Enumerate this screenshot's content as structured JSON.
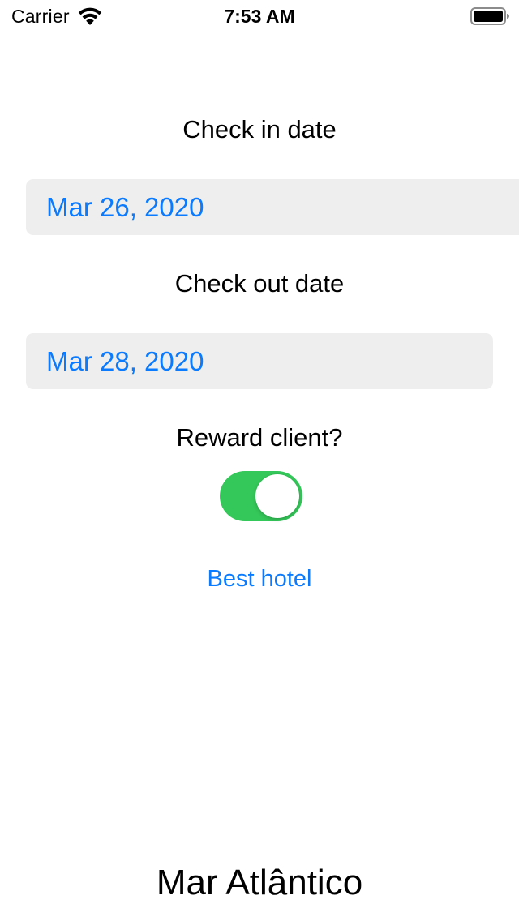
{
  "status_bar": {
    "carrier": "Carrier",
    "time": "7:53 AM",
    "wifi_icon": "wifi-icon",
    "battery_icon": "battery-full-icon"
  },
  "form": {
    "check_in_label": "Check in date",
    "check_in_value": "Mar 26, 2020",
    "check_out_label": "Check out date",
    "check_out_value": "Mar 28, 2020",
    "reward_label": "Reward client?",
    "reward_enabled": true,
    "best_hotel_button": "Best hotel"
  },
  "result": {
    "hotel_name": "Mar Atlântico"
  },
  "colors": {
    "accent": "#0a7aff",
    "toggle_on": "#34c759",
    "field_background": "#eeeeef"
  }
}
